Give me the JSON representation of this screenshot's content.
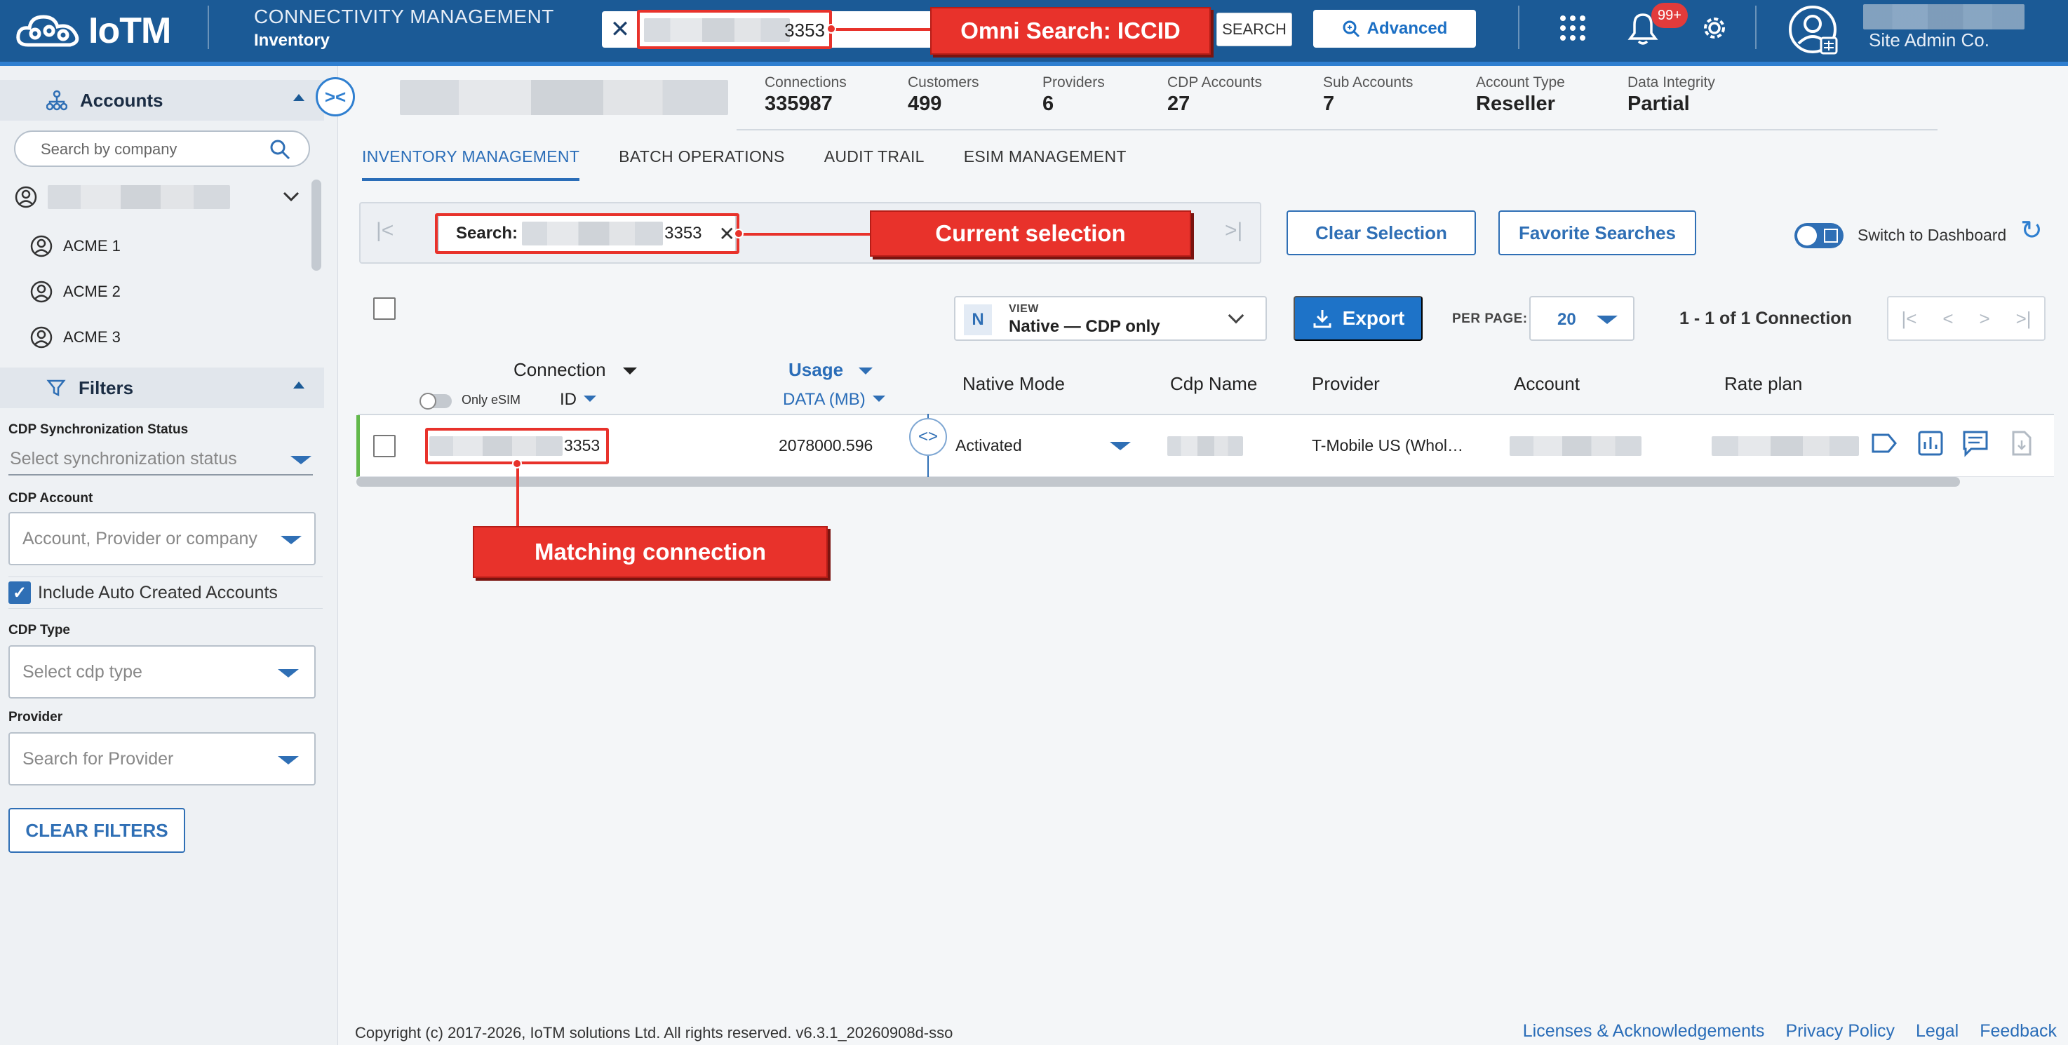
{
  "header": {
    "logo_text": "IoTM",
    "module_title": "CONNECTIVITY MANAGEMENT",
    "module_subtitle": "Inventory",
    "omni_search_value": "3353",
    "search_button_label": "SEARCH",
    "advanced_button_label": "Advanced",
    "notification_badge": "99+",
    "user_org": "Site Admin Co."
  },
  "sidebar": {
    "accounts_title": "Accounts",
    "company_search_placeholder": "Search by company",
    "tree_items": [
      "ACME 1",
      "ACME 2",
      "ACME 3"
    ],
    "filters_title": "Filters",
    "filters": {
      "sync_label": "CDP Synchronization Status",
      "sync_placeholder": "Select synchronization status",
      "account_label": "CDP Account",
      "account_placeholder": "Account, Provider or company",
      "include_auto_label": "Include Auto Created Accounts",
      "include_auto_checked": true,
      "cdp_type_label": "CDP Type",
      "cdp_type_placeholder": "Select cdp type",
      "provider_label": "Provider",
      "provider_placeholder": "Search for Provider"
    },
    "clear_filters_label": "CLEAR FILTERS"
  },
  "summary": {
    "stats": [
      {
        "label": "Connections",
        "value": "335987"
      },
      {
        "label": "Customers",
        "value": "499"
      },
      {
        "label": "Providers",
        "value": "6"
      },
      {
        "label": "CDP Accounts",
        "value": "27"
      },
      {
        "label": "Sub Accounts",
        "value": "7"
      },
      {
        "label": "Account Type",
        "value": "Reseller"
      },
      {
        "label": "Data Integrity",
        "value": "Partial"
      }
    ]
  },
  "tabs": [
    "INVENTORY MANAGEMENT",
    "BATCH OPERATIONS",
    "AUDIT TRAIL",
    "ESIM MANAGEMENT"
  ],
  "selection": {
    "chip_label": "Search:",
    "chip_value": "3353",
    "clear_selection_label": "Clear Selection",
    "favorite_searches_label": "Favorite Searches",
    "switch_label": "Switch to Dashboard"
  },
  "toolbar": {
    "view_caption": "VIEW",
    "view_letter": "N",
    "view_value": "Native — CDP only",
    "export_label": "Export",
    "per_page_label": "PER PAGE:",
    "per_page_value": "20",
    "range_text": "1 - 1 of 1 Connection"
  },
  "table": {
    "columns": {
      "connection": "Connection",
      "connection_sub": "ID",
      "only_esim": "Only eSIM",
      "usage": "Usage",
      "usage_sub": "DATA (MB)",
      "native_mode": "Native Mode",
      "cdp_name": "Cdp Name",
      "provider": "Provider",
      "account": "Account",
      "rate_plan": "Rate plan"
    },
    "rows": [
      {
        "connection_id_suffix": "3353",
        "usage": "2078000.596",
        "native_mode": "Activated",
        "provider": "T-Mobile US (Whol…"
      }
    ]
  },
  "callouts": {
    "omni": "Omni Search: ICCID",
    "selection": "Current selection",
    "matching": "Matching connection"
  },
  "footer": {
    "copyright": "Copyright (c) 2017-2026, IoTM solutions Ltd. All rights reserved. v6.3.1_20260908d-sso",
    "links": [
      "Licenses & Acknowledgements",
      "Privacy Policy",
      "Legal",
      "Feedback"
    ]
  },
  "colors": {
    "header_bg": "#1b5a96",
    "accent": "#2f6fb5",
    "callout_red": "#e8322b",
    "row_marker": "#62b84b"
  }
}
